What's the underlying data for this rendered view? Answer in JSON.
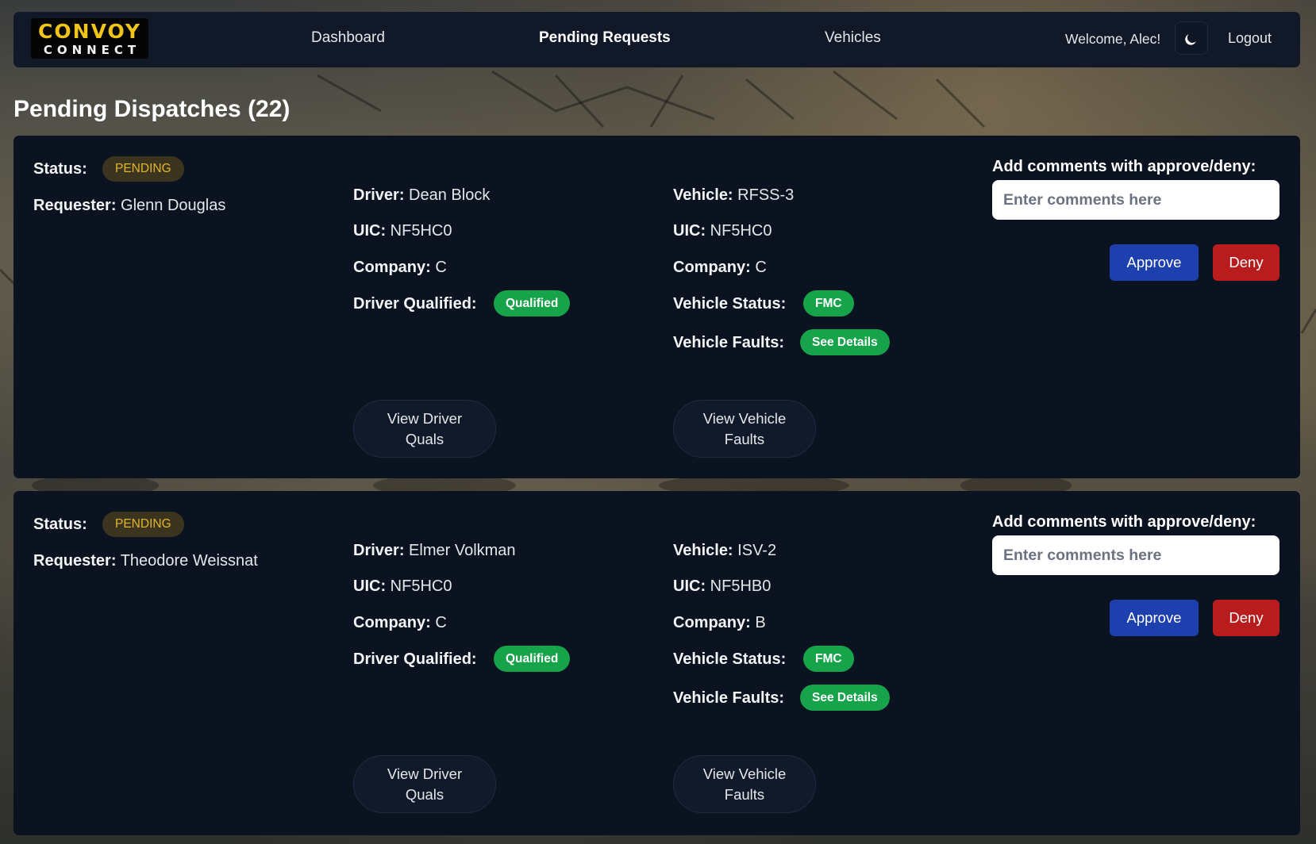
{
  "app": {
    "logo_top": "CONVOY",
    "logo_bottom": "CONNECT"
  },
  "nav": {
    "dashboard": "Dashboard",
    "pending_requests": "Pending Requests",
    "vehicles": "Vehicles",
    "welcome": "Welcome, Alec!",
    "logout": "Logout"
  },
  "page": {
    "title": "Pending Dispatches (22)"
  },
  "labels": {
    "status": "Status:",
    "requester": "Requester:",
    "driver": "Driver:",
    "uic": "UIC:",
    "company": "Company:",
    "driver_qualified": "Driver Qualified:",
    "vehicle": "Vehicle:",
    "vehicle_status": "Vehicle Status:",
    "vehicle_faults": "Vehicle Faults:",
    "comments": "Add comments with approve/deny:",
    "comments_placeholder": "Enter comments here",
    "view_driver_quals": "View Driver Quals",
    "view_vehicle_faults": "View Vehicle Faults",
    "approve": "Approve",
    "deny": "Deny"
  },
  "colors": {
    "card_bg": "#0b1220",
    "navbar_bg": "#111827",
    "pending_text": "#e3b52d",
    "qualified_green": "#16a34a",
    "approve_blue": "#1e40af",
    "deny_red": "#b91c1c",
    "logo_yellow": "#f0c419"
  },
  "icons": {
    "theme_toggle": "moon-icon"
  },
  "dispatches": [
    {
      "status": "PENDING",
      "requester": "Glenn Douglas",
      "driver": "Dean Block",
      "driver_uic": "NF5HC0",
      "driver_company": "C",
      "driver_qualified": "Qualified",
      "vehicle": "RFSS-3",
      "vehicle_uic": "NF5HC0",
      "vehicle_company": "C",
      "vehicle_status": "FMC",
      "vehicle_faults": "See Details"
    },
    {
      "status": "PENDING",
      "requester": "Theodore Weissnat",
      "driver": "Elmer Volkman",
      "driver_uic": "NF5HC0",
      "driver_company": "C",
      "driver_qualified": "Qualified",
      "vehicle": "ISV-2",
      "vehicle_uic": "NF5HB0",
      "vehicle_company": "B",
      "vehicle_status": "FMC",
      "vehicle_faults": "See Details"
    }
  ]
}
